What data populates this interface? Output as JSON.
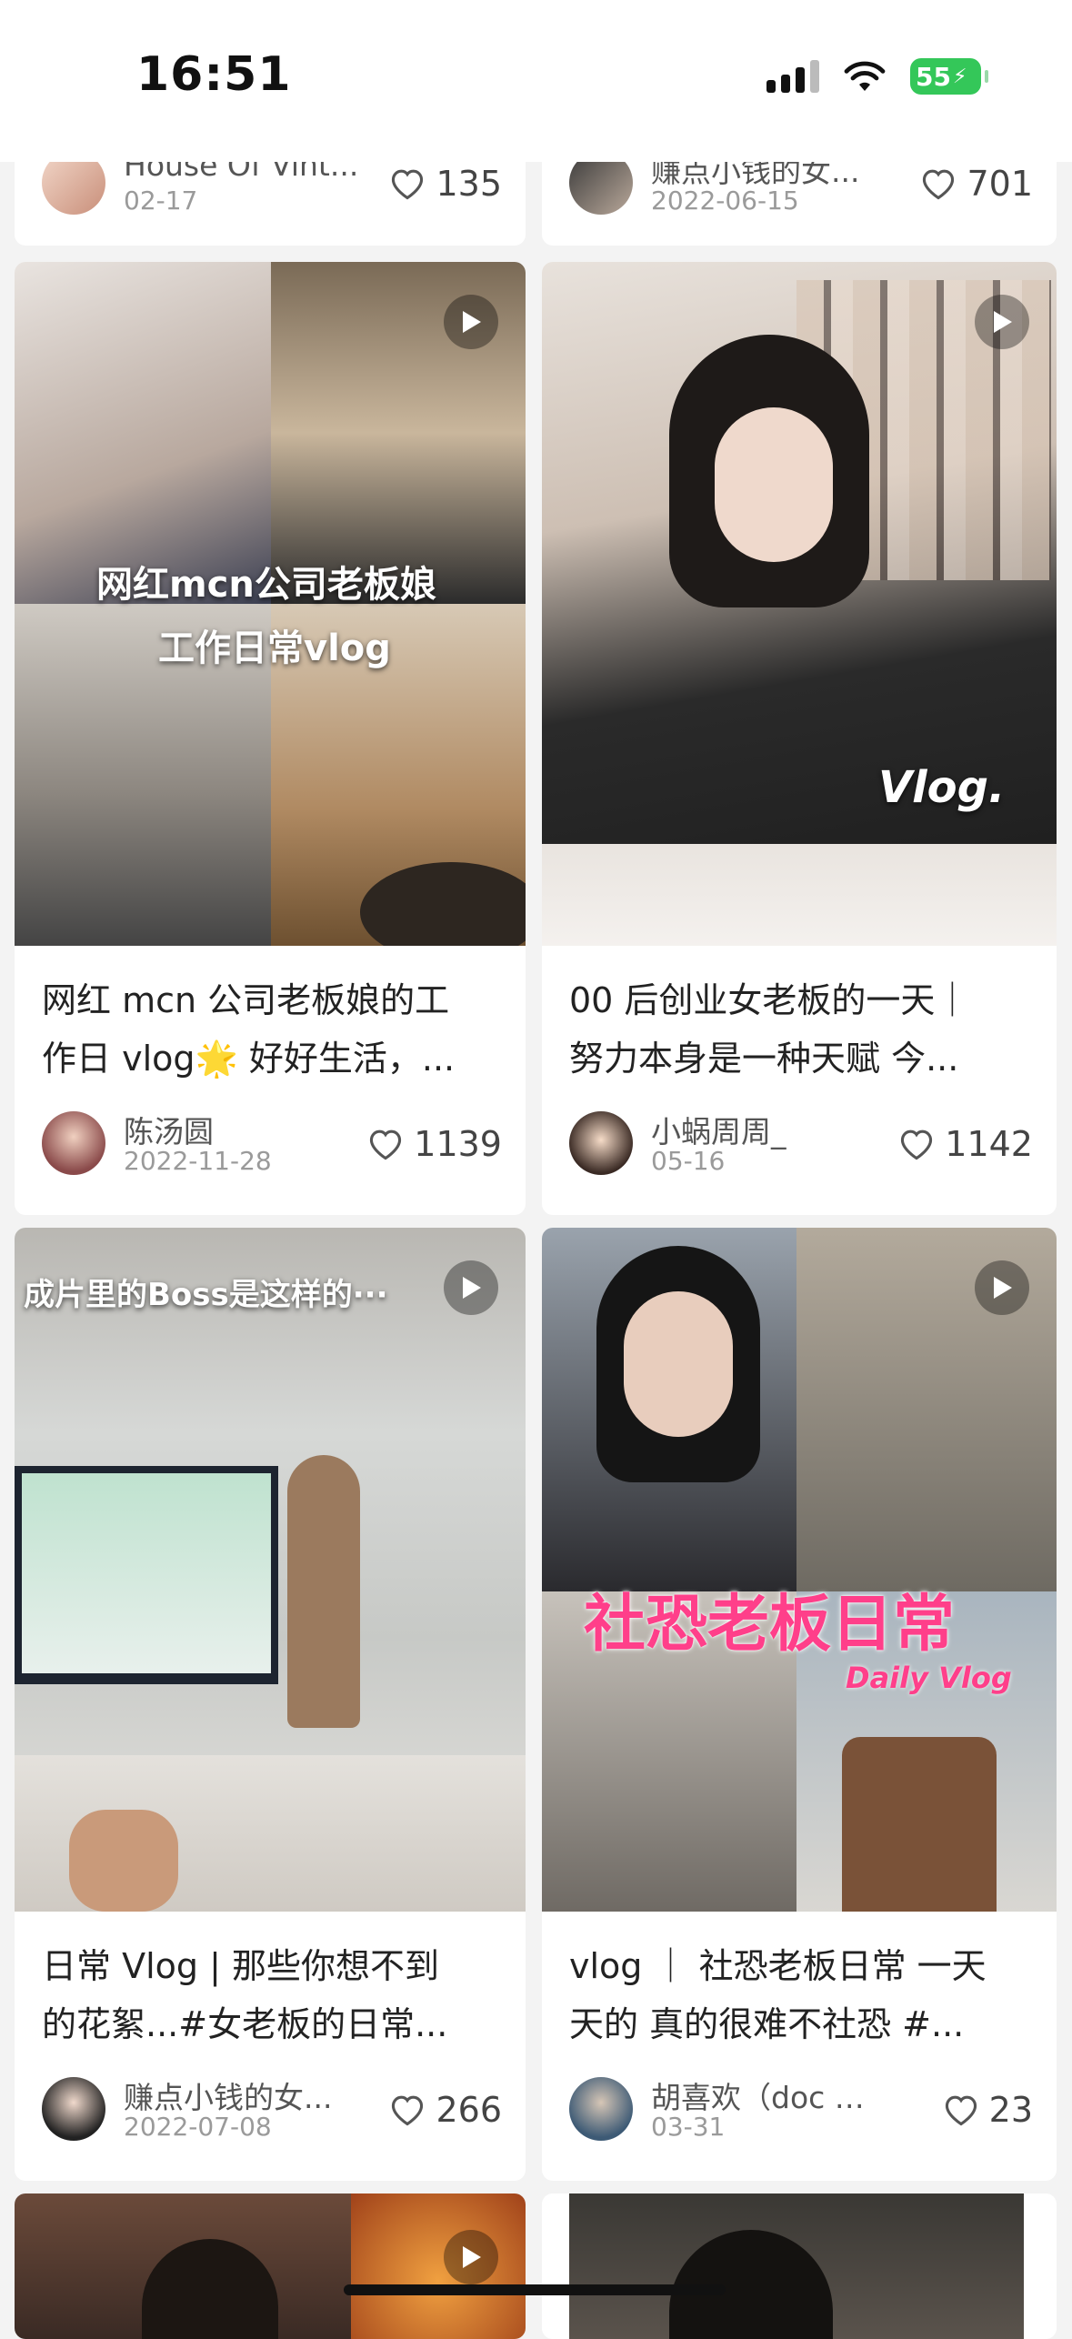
{
  "status_bar": {
    "time": "16:51",
    "battery": "55"
  },
  "colors": {
    "accent_battery": "#34c759",
    "background": "#f3f3f3",
    "card": "#ffffff"
  },
  "icons": {
    "like": "heart-outline-icon",
    "play": "play-icon"
  },
  "cards": [
    {
      "author": "House Of Vint...",
      "date": "02-17",
      "likes": "135"
    },
    {
      "author": "赚点小钱的女...",
      "date": "2022-06-15",
      "likes": "701"
    },
    {
      "overlay_line1": "网红mcn公司老板娘",
      "overlay_line2": "工作日常vlog",
      "title_line1": "网红 mcn 公司老板娘的工",
      "title_line2": "作日 vlog🌟 好好生活，...",
      "author": "陈汤圆",
      "date": "2022-11-28",
      "likes": "1139"
    },
    {
      "overlay_line1": "Vlog.",
      "title_line1": "00 后创业女老板的一天｜",
      "title_line2": "努力本身是一种天赋 今...",
      "author": "小蜗周周_",
      "date": "05-16",
      "likes": "1142"
    },
    {
      "overlay_line1": "成片里的Boss是这样的···",
      "title_line1": "日常 Vlog | 那些你想不到",
      "title_line2": "的花絮...#女老板的日常...",
      "author": "赚点小钱的女...",
      "date": "2022-07-08",
      "likes": "266"
    },
    {
      "overlay_line1": "社恐老板日常",
      "overlay_line2": "Daily Vlog",
      "title_line1": "vlog ｜ 社恐老板日常 一天",
      "title_line2": "天的 真的很难不社恐 #...",
      "author": "胡喜欢（doc 咖...",
      "date": "03-31",
      "likes": "23"
    }
  ]
}
